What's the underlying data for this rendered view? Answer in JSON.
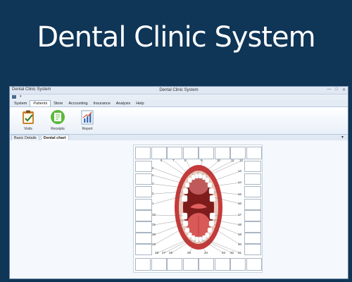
{
  "banner": {
    "title": "Dental Clinic System"
  },
  "window": {
    "app_name": "Dental Clinic System",
    "title": "Dental Clinic System",
    "controls": [
      "—",
      "□",
      "✕"
    ]
  },
  "menu": [
    "System",
    "Patients",
    "Store",
    "Accounting",
    "Insurance",
    "Analysis",
    "Help"
  ],
  "menu_active": "Patients",
  "ribbon": [
    {
      "label": "Visits",
      "icon": "visits-clipboard-icon",
      "color": "#c9842d"
    },
    {
      "label": "Receipts",
      "icon": "receipts-document-icon",
      "color": "#5cb83a"
    },
    {
      "label": "Report",
      "icon": "report-chart-icon",
      "color": "#3f6fb5"
    }
  ],
  "tabs": [
    {
      "label": "Basic Details",
      "active": false
    },
    {
      "label": "Dental chart",
      "active": true
    }
  ],
  "tabs_dropdown": "▼",
  "tooth_numbers": {
    "top": [
      "6",
      "7",
      "8",
      "9",
      "10",
      "11",
      "12"
    ],
    "left_upper": [
      "5",
      "4",
      "3",
      "2",
      "1"
    ],
    "right_upper": [
      "13",
      "14",
      "15",
      "16"
    ],
    "left_lower": [
      "32",
      "31",
      "30",
      "29"
    ],
    "right_lower": [
      "17",
      "18",
      "19",
      "20"
    ],
    "bottom": [
      "28",
      "27",
      "26",
      "25",
      "24",
      "23",
      "22",
      "21"
    ]
  }
}
